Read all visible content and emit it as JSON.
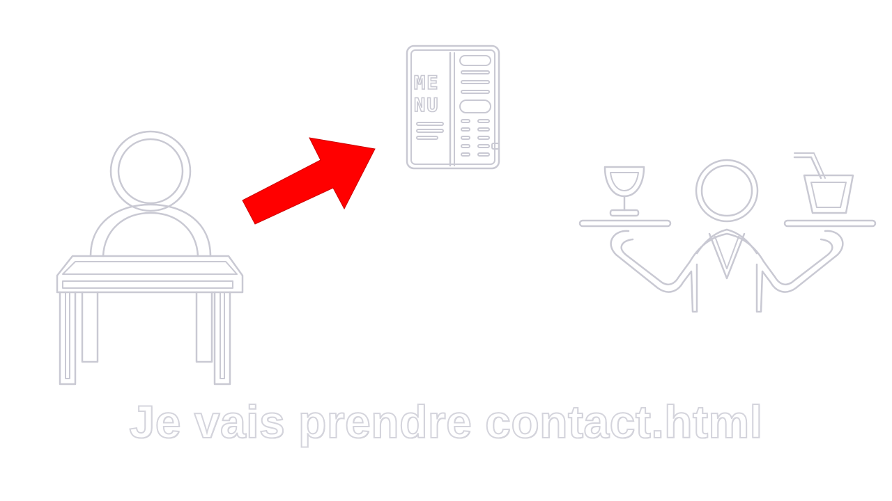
{
  "caption": "Je vais prendre contact.html",
  "icons": {
    "diner": "person-at-table-icon",
    "arrow": "arrow-up-right-icon",
    "menu": "menu-card-icon",
    "waiter": "waiter-with-drinks-icon"
  },
  "menu_card": {
    "line1": "ME",
    "line2": "NU"
  },
  "colors": {
    "background": "#ffffff",
    "outline": "#c9c9d3",
    "arrow": "#ff0000"
  }
}
